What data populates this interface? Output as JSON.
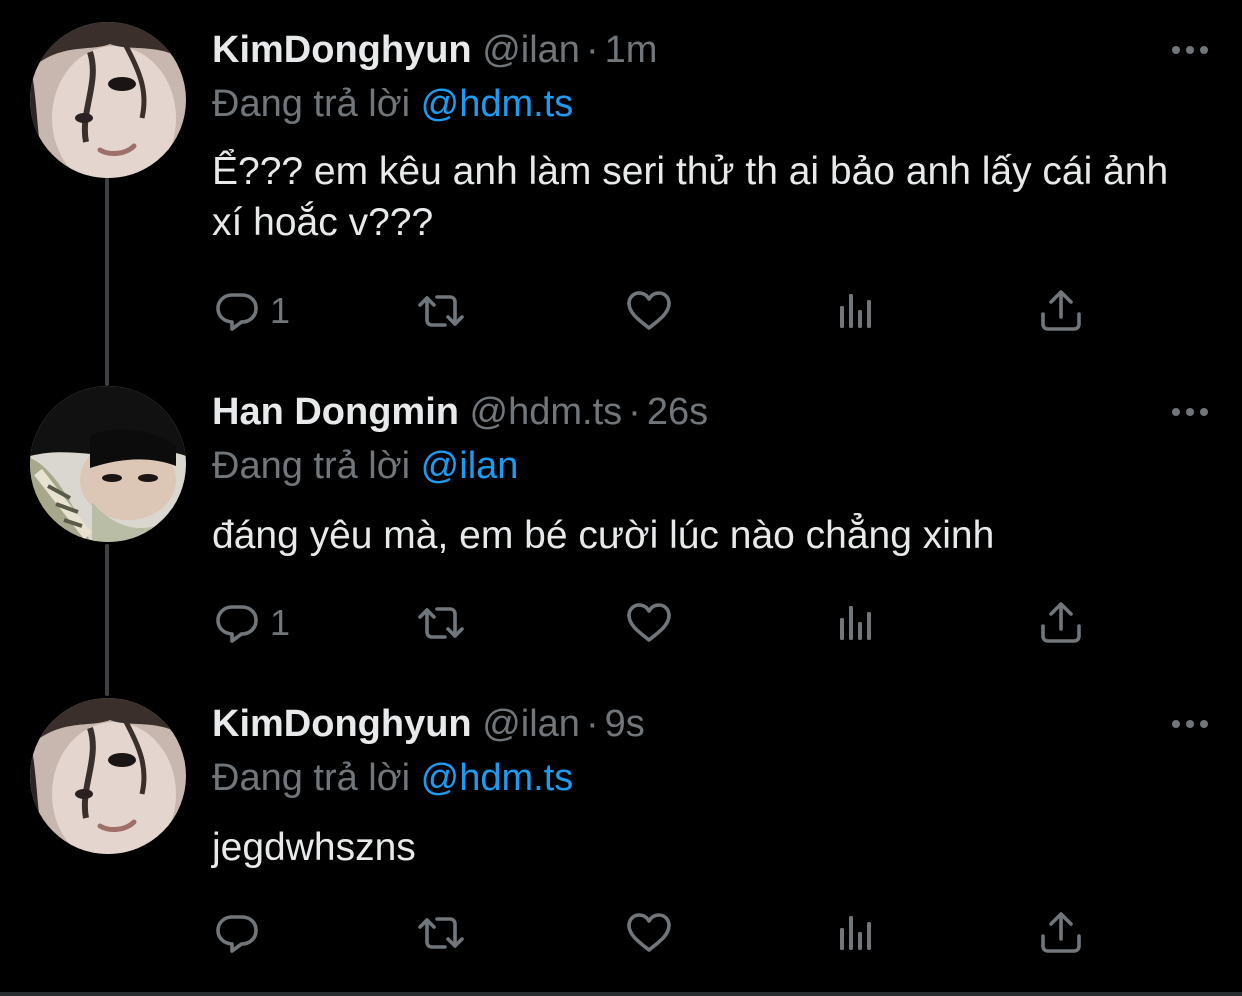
{
  "colors": {
    "background": "#000000",
    "text": "#e7e9ea",
    "muted": "#71767b",
    "mention": "#1d9bf0"
  },
  "tweets": [
    {
      "display_name": "KimDonghyun",
      "handle": "@ilan",
      "separator": "·",
      "time": "1m",
      "reply_prefix": "Đang trả lời",
      "reply_to": "@hdm.ts",
      "text": "Ể??? em kêu anh làm seri thử th ai bảo anh lấy cái ảnh xí hoắc v???",
      "reply_count": "1",
      "avatar_icon": "profile-photo"
    },
    {
      "display_name": "Han Dongmin",
      "handle": "@hdm.ts",
      "separator": "·",
      "time": "26s",
      "reply_prefix": "Đang trả lời",
      "reply_to": "@ilan",
      "text": "đáng yêu mà, em bé cười lúc nào chẳng xinh",
      "reply_count": "1",
      "avatar_icon": "profile-photo"
    },
    {
      "display_name": "KimDonghyun",
      "handle": "@ilan",
      "separator": "·",
      "time": "9s",
      "reply_prefix": "Đang trả lời",
      "reply_to": "@hdm.ts",
      "text": "jegdwhszns",
      "reply_count": "",
      "avatar_icon": "profile-photo"
    }
  ],
  "action_icons": [
    "reply-icon",
    "retweet-icon",
    "like-icon",
    "views-icon",
    "share-icon"
  ]
}
